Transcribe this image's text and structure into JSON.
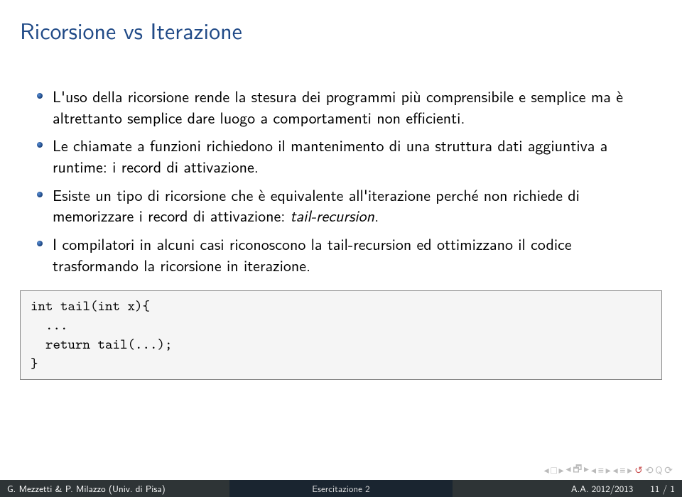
{
  "title": "Ricorsione vs Iterazione",
  "bullets": [
    {
      "text": "L'uso della ricorsione rende la stesura dei programmi più comprensibile e semplice ma è altrettanto semplice dare luogo a comportamenti non efficienti."
    },
    {
      "text": "Le chiamate a funzioni richiedono il mantenimento di una struttura dati aggiuntiva a runtime: i record di attivazione."
    },
    {
      "text_prefix": "Esiste un tipo di ricorsione che è equivalente all'iterazione perché non richiede di memorizzare i record di attivazione: ",
      "text_italic": "tail-recursion",
      "text_suffix": "."
    },
    {
      "text": "I compilatori in alcuni casi riconoscono la tail-recursion ed ottimizzano il codice trasformando la ricorsione in iterazione."
    }
  ],
  "code": "int tail(int x){\n  ...\n  return tail(...);\n}",
  "footer": {
    "left": "G. Mezzetti & P. Milazzo (Univ. di Pisa)",
    "center": "Esercitazione 2",
    "right_year": "A.A. 2012/2013",
    "right_page": "11 / 1"
  },
  "nav": {
    "sym1": "◂ □ ▸",
    "sym2": "◂ 🗗 ▸",
    "sym3": "◂ ≡ ▸",
    "sym4": "◂ ≡ ▸",
    "sym5": "↺",
    "sym6": "⟲ Q ⟳"
  }
}
